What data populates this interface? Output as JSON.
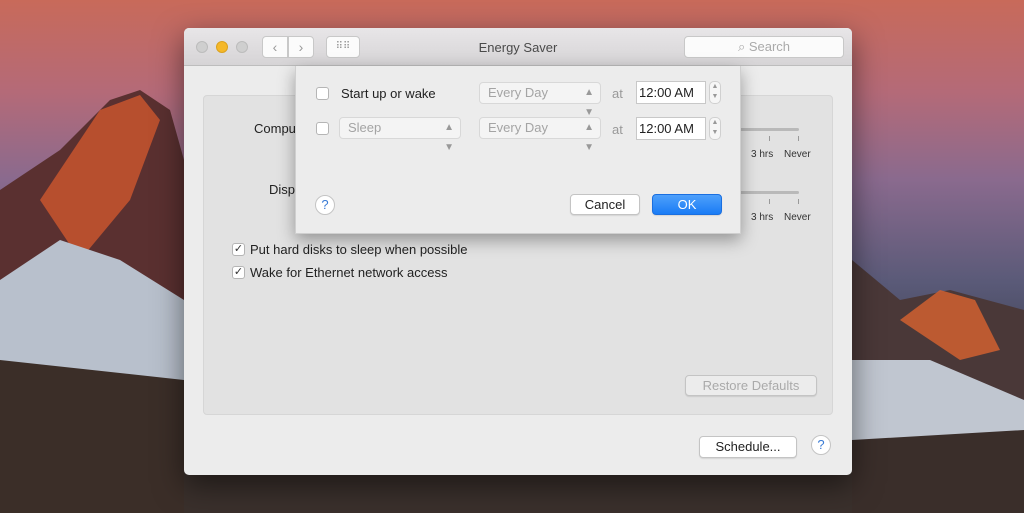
{
  "window": {
    "title": "Energy Saver",
    "search_placeholder": "Search"
  },
  "panel": {
    "computer_sleep_label": "Computer sleep:",
    "display_sleep_label": "Display sleep:",
    "slider_ticks": [
      "3 hrs",
      "Never"
    ],
    "options": [
      {
        "label": "Put hard disks to sleep when possible",
        "checked": true
      },
      {
        "label": "Wake for Ethernet network access",
        "checked": true
      }
    ],
    "restore_defaults": "Restore Defaults",
    "schedule": "Schedule...",
    "help": "?"
  },
  "schedule_sheet": {
    "rows": [
      {
        "checked": false,
        "event": "Start up or wake",
        "frequency": "Every Day",
        "at": "at",
        "time": "12:00 AM"
      },
      {
        "checked": false,
        "event": "Sleep",
        "frequency": "Every Day",
        "at": "at",
        "time": "12:00 AM"
      }
    ],
    "help": "?",
    "cancel": "Cancel",
    "ok": "OK"
  },
  "colors": {
    "accent": "#1a7cf5",
    "minimize": "#f5b829"
  }
}
